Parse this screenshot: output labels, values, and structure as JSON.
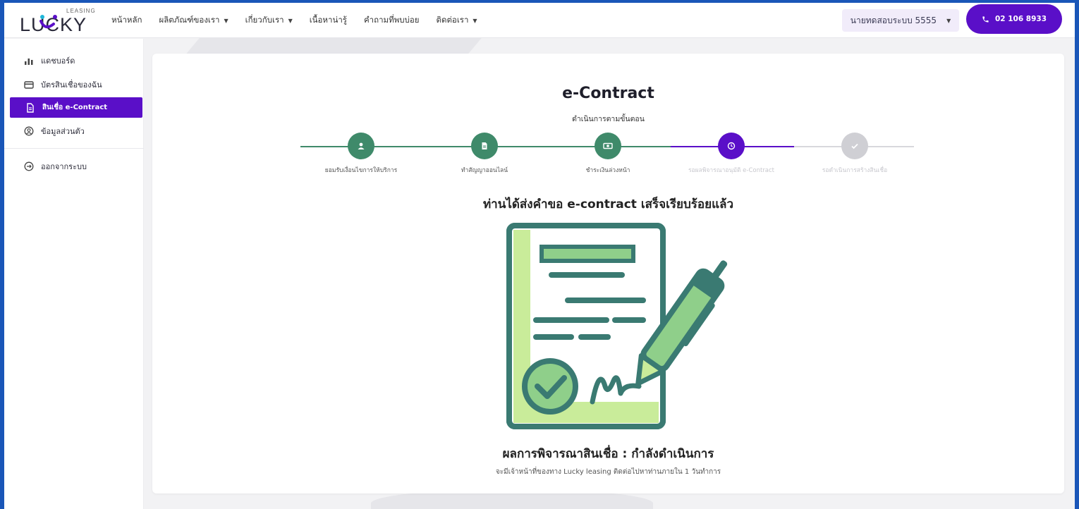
{
  "header": {
    "logo_text": "LUCKY",
    "logo_sub": "LEASING",
    "nav": [
      {
        "label": "หน้าหลัก",
        "has_caret": false
      },
      {
        "label": "ผลิตภัณฑ์ของเรา",
        "has_caret": true
      },
      {
        "label": "เกี่ยวกับเรา",
        "has_caret": true
      },
      {
        "label": "เนื้อหาน่ารู้",
        "has_caret": false
      },
      {
        "label": "คำถามที่พบบ่อย",
        "has_caret": false
      },
      {
        "label": "ติดต่อเรา",
        "has_caret": true
      }
    ],
    "user_label": "นายทดสอบระบบ 5555",
    "phone": "02 106 8933"
  },
  "sidebar": {
    "items": [
      {
        "label": "แดชบอร์ด",
        "icon": "chart-icon"
      },
      {
        "label": "บัตรสินเชื่อของฉัน",
        "icon": "card-icon"
      },
      {
        "label": "สินเชื่อ e-Contract",
        "icon": "document-icon",
        "active": true
      },
      {
        "label": "ข้อมูลส่วนตัว",
        "icon": "user-circle-icon"
      }
    ],
    "logout": {
      "label": "ออกจากระบบ",
      "icon": "logout-icon"
    }
  },
  "main": {
    "title": "e-Contract",
    "subtitle": "ดำเนินการตามขั้นตอน",
    "steps": [
      {
        "label": "ยอมรับเงื่อนไขการให้บริการ",
        "state": "done",
        "icon": "user-icon"
      },
      {
        "label": "ทำสัญญาออนไลน์",
        "state": "done",
        "icon": "document-icon"
      },
      {
        "label": "ชำระเงินล่วงหน้า",
        "state": "done",
        "icon": "money-icon"
      },
      {
        "label": "รอผลพิจารณาอนุมัติ e-Contract",
        "state": "current",
        "icon": "clock-icon"
      },
      {
        "label": "รอดำเนินการสร้างสินเชื่อ",
        "state": "pending",
        "icon": "check-icon"
      }
    ],
    "headline": "ท่านได้ส่งคำขอ e-contract เสร็จเรียบร้อยแล้ว",
    "result": "ผลการพิจารณาสินเชื่อ : กำลังดำเนินการ",
    "note": "จะมีเจ้าหน้าที่ของทาง Lucky leasing ติดต่อไปหาท่านภายใน 1 วันทำการ"
  },
  "colors": {
    "brand": "#5a0fc8",
    "done": "#3f8a6a",
    "pending": "#cfcfd4",
    "illus_stroke": "#3a7a72",
    "illus_fill": "#c9ec9a"
  }
}
